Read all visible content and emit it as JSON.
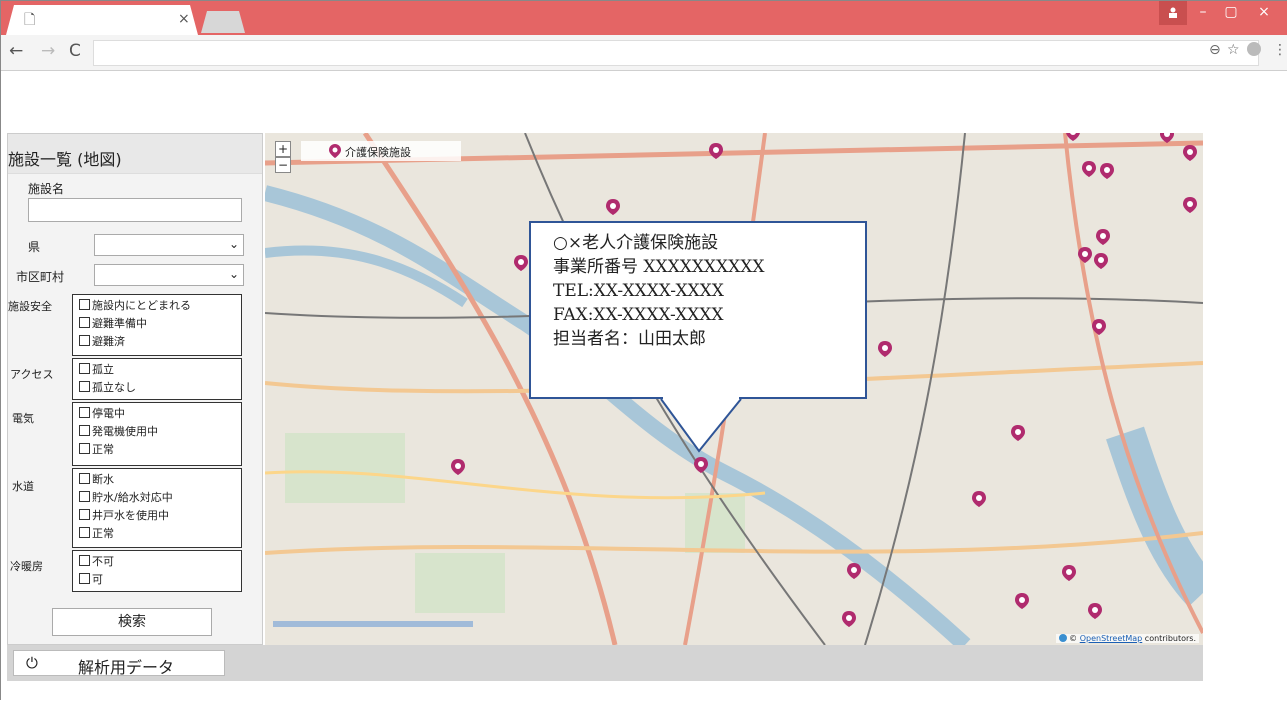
{
  "browser": {
    "tab_icon": "document-icon",
    "tab_close": "×",
    "back": "←",
    "forward": "→",
    "reload": "C",
    "url": "",
    "zoom_icon": "⊖",
    "star_icon": "☆",
    "menu_icon": "⋮",
    "window_controls": {
      "user": "👤",
      "minimize": "–",
      "restore": "▢",
      "close": "×"
    },
    "titlebar_color": "#e46565"
  },
  "sidebar": {
    "title": "施設一覧 (地図)",
    "facility_name_label": "施設名",
    "facility_name_value": "",
    "prefecture_label": "県",
    "prefecture_value": "",
    "city_label": "市区町村",
    "city_value": "",
    "groups": [
      {
        "label": "施設安全",
        "options": [
          "施設内にとどまれる",
          "避難準備中",
          "避難済"
        ]
      },
      {
        "label": "アクセス",
        "options": [
          "孤立",
          "孤立なし"
        ]
      },
      {
        "label": "電気",
        "options": [
          "停電中",
          "発電機使用中",
          "正常"
        ]
      },
      {
        "label": "水道",
        "options": [
          "断水",
          "貯水/給水対応中",
          "井戸水を使用中",
          "正常"
        ]
      },
      {
        "label": "冷暖房",
        "options": [
          "不可",
          "可"
        ]
      }
    ],
    "search_button": "検索"
  },
  "map": {
    "zoom_in": "+",
    "zoom_out": "−",
    "legend_label": "介護保険施設",
    "marker_color": "#b02b6e",
    "attribution_prefix": "© ",
    "attribution_link": "OpenStreetMap",
    "attribution_suffix": " contributors.",
    "popup": {
      "line1": "○×老人介護保険施設",
      "line2": "事業所番号 XXXXXXXXXX",
      "line3": "TEL:XX-XXXX-XXXX",
      "line4": "FAX:XX-XXXX-XXXX",
      "line5": "担当者名：山田太郎"
    }
  },
  "bottom": {
    "icon": "power-icon",
    "icon_glyph": "⏻",
    "tab_label": "解析用データ"
  }
}
